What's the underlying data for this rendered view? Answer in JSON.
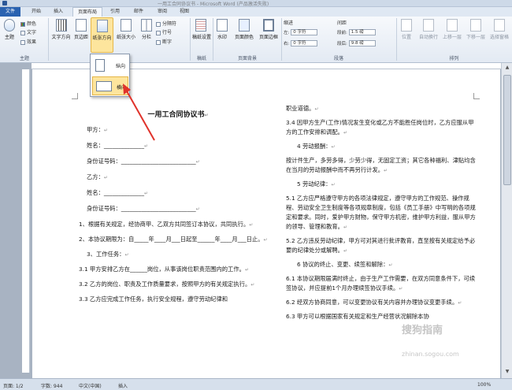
{
  "window": {
    "title": "一用工合同协议书 - Microsoft Word (产品激活失败)"
  },
  "tabs": [
    "文件",
    "开始",
    "插入",
    "页面布局",
    "引用",
    "邮件",
    "审阅",
    "视图"
  ],
  "active_tab": "页面布局",
  "ribbon": {
    "theme_group": {
      "label": "主题",
      "main": "主题",
      "items": [
        "颜色",
        "文字",
        "效果"
      ]
    },
    "page_setup": {
      "label": "页面设置",
      "text_direction": "文字方向",
      "margins": "页边距",
      "orientation": "纸张方向",
      "size": "纸张大小",
      "columns": "分栏",
      "small": [
        "分隔符",
        "行号",
        "断字"
      ]
    },
    "manuscript": {
      "label": "稿纸",
      "button": "稿纸设置"
    },
    "page_background": {
      "label": "页面背景",
      "items": [
        "水印",
        "页面颜色",
        "页面边框"
      ]
    },
    "paragraph": {
      "label": "段落",
      "indent_title": "缩进",
      "spacing_title": "间距",
      "indent_left_label": "左:",
      "indent_left": "0 字符",
      "indent_right_label": "右:",
      "indent_right": "0 字符",
      "spacing_before_label": "段前:",
      "spacing_before": "1.5 磅",
      "spacing_after_label": "段后:",
      "spacing_after": "9.8 磅"
    },
    "arrange": {
      "label": "排列",
      "items": [
        "位置",
        "自动换行",
        "上移一层",
        "下移一层",
        "选择窗格"
      ]
    }
  },
  "orientation_menu": {
    "options": [
      "纵向",
      "横向"
    ],
    "hovered": "横向"
  },
  "document": {
    "title": "一用工合同协议书",
    "left_column": [
      "甲方：",
      "姓名：______________",
      "身份证号码：__________________________",
      "乙方：",
      "姓名：______________",
      "身份证号码：__________________________",
      "1、根据有关规定，经协商甲、乙双方共同签订本协议，共同执行。",
      "2、本协议期限为：自_____年____月___日起至______年____月___日止。",
      "3、工作任务：",
      "3.1 甲方安排乙方在______岗位，从事该岗位职责范围内的工作。",
      "3.2 乙方的岗位、职责及工作质量要求，按照甲方的有关规定执行。",
      "3.3 乙方应完成工作任务，执行安全规程，遵守劳动纪律和"
    ],
    "right_column": [
      "职业道德。",
      "3.4 因甲方生产(工作)情况发生变化或乙方不能胜任岗位时，乙方应服从甲方的工作安排和调配。",
      "4 劳动报酬：",
      "按计件生产，多劳多得，少劳少得，无固定工资；其它各种福利、津贴均含在当月的劳动报酬中而不再另行计发。",
      "5 劳动纪律：",
      "5.1 乙方应严格遵守甲方的各项法律规定，遵守甲方的工作规范、操作规程、劳动安全卫生制度等各项规章制度，包括《员工手册》中写明的各项规定和要求。同时，爱护甲方财物，保守甲方机密，维护甲方利益，服从甲方的领导、管理和教育。",
      "5.2 乙方违反劳动纪律，甲方可对其进行批评教育，直至按有关规定给予必要的纪律处分或解聘。",
      "6 协议的终止、变更、续签和解除：",
      "6.1 本协议期限届满时终止，由于生产工作需要，在双方同意条件下，可续签协议，并应提前1个月办理续签协议手续。",
      "6.2 经双方协商同意，可以变更协议有关内容并办理协议变更手续。",
      "6.3 甲方可以根据国家有关规定和生产经营状况解除本协"
    ]
  },
  "status_bar": [
    "页面: 1/2",
    "字数: 944",
    "中文(中国)",
    "插入",
    "100%"
  ],
  "watermark": {
    "brand": "搜狗指南",
    "url": "zhinan.sogou.com"
  },
  "colors": {
    "file_tab": "#2a62b0",
    "highlight": "#fde59d",
    "arrow": "#e0332b"
  }
}
